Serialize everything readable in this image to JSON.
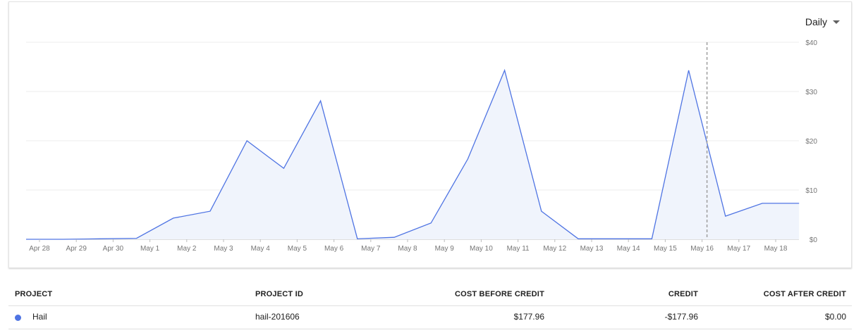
{
  "controls": {
    "period": "Daily"
  },
  "chart_data": {
    "type": "area",
    "categories": [
      "Apr 28",
      "Apr 29",
      "Apr 30",
      "May 1",
      "May 2",
      "May 3",
      "May 4",
      "May 5",
      "May 6",
      "May 7",
      "May 8",
      "May 9",
      "May 10",
      "May 11",
      "May 12",
      "May 13",
      "May 14",
      "May 15",
      "May 16",
      "May 17",
      "May 18"
    ],
    "values": [
      0,
      0,
      0.1,
      0.2,
      4.3,
      5.7,
      20,
      14.4,
      28.1,
      0.1,
      0.4,
      3.3,
      16.3,
      34.3,
      5.7,
      0.1,
      0.1,
      0.1,
      34.3,
      4.7,
      7.3,
      7.3
    ],
    "y_ticks": [
      "$0",
      "$10",
      "$20",
      "$30",
      "$40"
    ],
    "ylim": [
      0,
      40
    ],
    "grid": true,
    "line_color": "#4f74e3",
    "fill_color": "#f0f4fc",
    "marker_position": "May 16"
  },
  "table": {
    "headers": {
      "project": "PROJECT",
      "project_id": "PROJECT ID",
      "cost_before_credit": "COST BEFORE CREDIT",
      "credit": "CREDIT",
      "cost_after_credit": "COST AFTER CREDIT"
    },
    "rows": [
      {
        "project": "Hail",
        "project_id": "hail-201606",
        "cost_before_credit": "$177.96",
        "credit": "-$177.96",
        "cost_after_credit": "$0.00",
        "color": "#4f74e3"
      }
    ]
  }
}
